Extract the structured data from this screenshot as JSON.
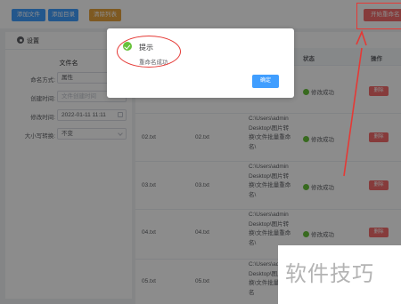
{
  "toolbar": {
    "add_file": "添加文件",
    "add_dir": "添加目录",
    "clear": "清除列表",
    "start": "开始重命名"
  },
  "settings": {
    "title": "设置",
    "section": "文件名",
    "rows": [
      {
        "label": "命名方式:",
        "value": "属性",
        "placeholder": false
      },
      {
        "label": "创建时间:",
        "value": "文件创建时间",
        "placeholder": true
      },
      {
        "label": "修改时间:",
        "value": "2022-01-11 11:11",
        "placeholder": false
      },
      {
        "label": "大小写转换:",
        "value": "不变",
        "placeholder": false
      }
    ]
  },
  "table": {
    "columns": {
      "status": "状态",
      "ops": "操作"
    },
    "rows": [
      {
        "name": "",
        "new_name": "",
        "path": "\\",
        "status": "修改成功",
        "delete": "删除"
      },
      {
        "name": "02.txt",
        "new_name": "02.txt",
        "path": "C:\\Users\\adminDesktop\\图片转换\\文件批量重命名\\",
        "status": "修改成功",
        "delete": "删除"
      },
      {
        "name": "03.txt",
        "new_name": "03.txt",
        "path": "C:\\Users\\adminDesktop\\图片转换\\文件批量重命名\\",
        "status": "修改成功",
        "delete": "删除"
      },
      {
        "name": "04.txt",
        "new_name": "04.txt",
        "path": "C:\\Users\\adminDesktop\\图片转换\\文件批量重命名\\",
        "status": "修改成功",
        "delete": "删除"
      },
      {
        "name": "05.txt",
        "new_name": "05.txt",
        "path": "C:\\Users\\adminDesktop\\图片转换\\文件批量重命名",
        "status": "修改成功",
        "delete": ""
      }
    ]
  },
  "dialog": {
    "title": "提示",
    "message": "重命名成功",
    "ok": "确定"
  },
  "watermark": "软件技巧",
  "colors": {
    "primary": "#409eff",
    "danger": "#f56c6c",
    "warning": "#e6a23c",
    "success": "#67c23a",
    "annotation": "#e53935"
  }
}
